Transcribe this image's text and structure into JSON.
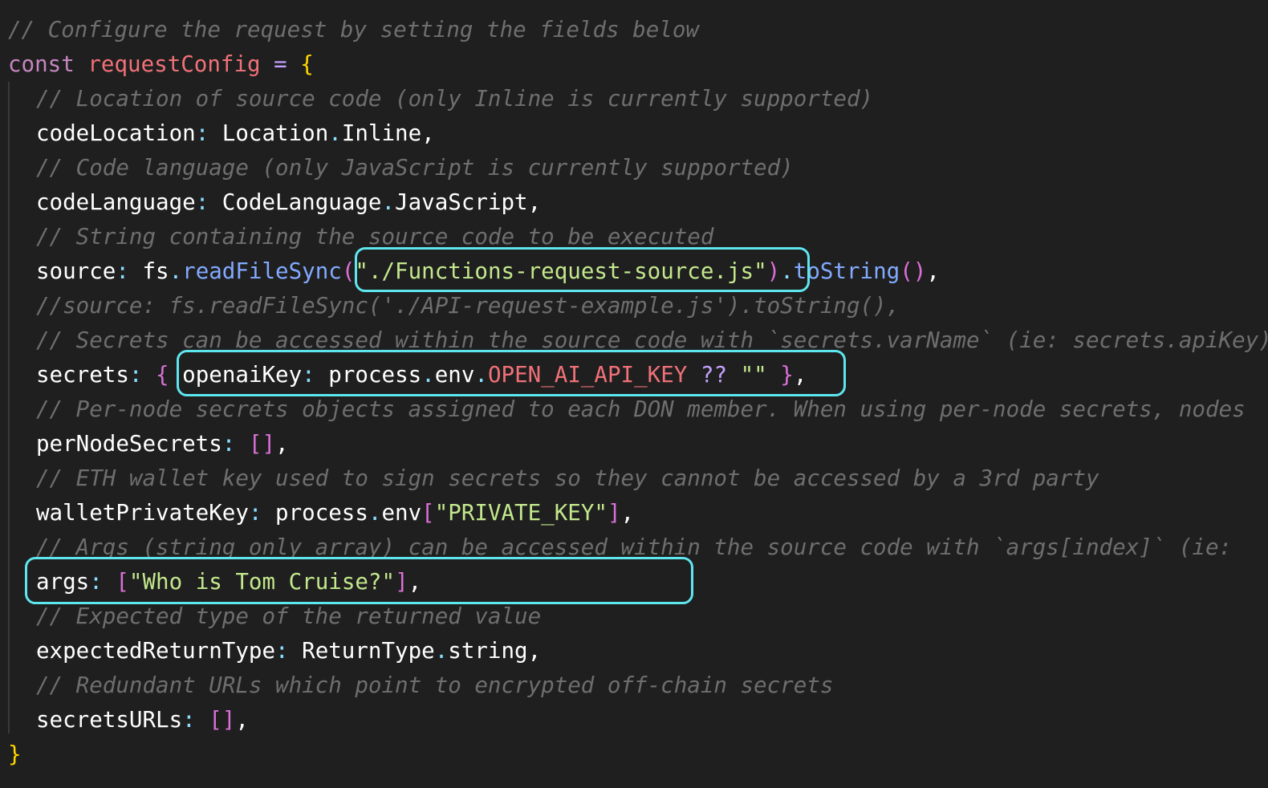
{
  "editor": {
    "lines": [
      {
        "parts": [
          {
            "t": "// Configure the request by setting the fields below",
            "c": "cm"
          }
        ]
      },
      {
        "parts": [
          {
            "t": "const",
            "c": "kw"
          },
          {
            "t": " ",
            "c": "id"
          },
          {
            "t": "requestConfig",
            "c": "var"
          },
          {
            "t": " ",
            "c": "id"
          },
          {
            "t": "=",
            "c": "op"
          },
          {
            "t": " ",
            "c": "id"
          },
          {
            "t": "{",
            "c": "br"
          }
        ]
      },
      {
        "indent": true,
        "parts": [
          {
            "t": "// Location of source code (only Inline is currently supported)",
            "c": "cm"
          }
        ]
      },
      {
        "indent": true,
        "parts": [
          {
            "t": "codeLocation",
            "c": "pr"
          },
          {
            "t": ":",
            "c": "pun"
          },
          {
            "t": " Location",
            "c": "id"
          },
          {
            "t": ".",
            "c": "pun"
          },
          {
            "t": "Inline",
            "c": "id"
          },
          {
            "t": ",",
            "c": "id"
          }
        ]
      },
      {
        "indent": true,
        "parts": [
          {
            "t": "// Code language (only JavaScript is currently supported)",
            "c": "cm"
          }
        ]
      },
      {
        "indent": true,
        "parts": [
          {
            "t": "codeLanguage",
            "c": "pr"
          },
          {
            "t": ":",
            "c": "pun"
          },
          {
            "t": " CodeLanguage",
            "c": "id"
          },
          {
            "t": ".",
            "c": "pun"
          },
          {
            "t": "JavaScript",
            "c": "id"
          },
          {
            "t": ",",
            "c": "id"
          }
        ]
      },
      {
        "indent": true,
        "parts": [
          {
            "t": "// String containing the source code to be executed",
            "c": "cm"
          }
        ]
      },
      {
        "indent": true,
        "parts": [
          {
            "t": "source",
            "c": "pr"
          },
          {
            "t": ":",
            "c": "pun"
          },
          {
            "t": " fs",
            "c": "id"
          },
          {
            "t": ".",
            "c": "pun"
          },
          {
            "t": "readFileSync",
            "c": "fn"
          },
          {
            "t": "(",
            "c": "br2"
          },
          {
            "t": "\"./Functions-request-source.js\"",
            "c": "str"
          },
          {
            "t": ")",
            "c": "br2"
          },
          {
            "t": ".",
            "c": "pun"
          },
          {
            "t": "toString",
            "c": "fn"
          },
          {
            "t": "()",
            "c": "br2"
          },
          {
            "t": ",",
            "c": "id"
          }
        ]
      },
      {
        "indent": true,
        "parts": [
          {
            "t": "//source: fs.readFileSync('./API-request-example.js').toString(),",
            "c": "cm"
          }
        ]
      },
      {
        "indent": true,
        "parts": [
          {
            "t": "// Secrets can be accessed within the source code with `secrets.varName` (ie: secrets.apiKey)",
            "c": "cm"
          }
        ]
      },
      {
        "indent": true,
        "parts": [
          {
            "t": "secrets",
            "c": "pr"
          },
          {
            "t": ":",
            "c": "pun"
          },
          {
            "t": " ",
            "c": "id"
          },
          {
            "t": "{",
            "c": "br2"
          },
          {
            "t": " ",
            "c": "id"
          },
          {
            "t": "openaiKey",
            "c": "pr"
          },
          {
            "t": ":",
            "c": "pun"
          },
          {
            "t": " process",
            "c": "id"
          },
          {
            "t": ".",
            "c": "pun"
          },
          {
            "t": "env",
            "c": "id"
          },
          {
            "t": ".",
            "c": "pun"
          },
          {
            "t": "OPEN_AI_API_KEY",
            "c": "env"
          },
          {
            "t": " ",
            "c": "id"
          },
          {
            "t": "??",
            "c": "op"
          },
          {
            "t": " ",
            "c": "id"
          },
          {
            "t": "\"\"",
            "c": "str"
          },
          {
            "t": " ",
            "c": "id"
          },
          {
            "t": "}",
            "c": "br2"
          },
          {
            "t": ",",
            "c": "id"
          }
        ]
      },
      {
        "indent": true,
        "parts": [
          {
            "t": "// Per-node secrets objects assigned to each DON member. When using per-node secrets, nodes",
            "c": "cm"
          }
        ]
      },
      {
        "indent": true,
        "parts": [
          {
            "t": "perNodeSecrets",
            "c": "pr"
          },
          {
            "t": ":",
            "c": "pun"
          },
          {
            "t": " ",
            "c": "id"
          },
          {
            "t": "[]",
            "c": "br2"
          },
          {
            "t": ",",
            "c": "id"
          }
        ]
      },
      {
        "indent": true,
        "parts": [
          {
            "t": "// ETH wallet key used to sign secrets so they cannot be accessed by a 3rd party",
            "c": "cm"
          }
        ]
      },
      {
        "indent": true,
        "parts": [
          {
            "t": "walletPrivateKey",
            "c": "pr"
          },
          {
            "t": ":",
            "c": "pun"
          },
          {
            "t": " process",
            "c": "id"
          },
          {
            "t": ".",
            "c": "pun"
          },
          {
            "t": "env",
            "c": "id"
          },
          {
            "t": "[",
            "c": "br2"
          },
          {
            "t": "\"PRIVATE_KEY\"",
            "c": "str"
          },
          {
            "t": "]",
            "c": "br2"
          },
          {
            "t": ",",
            "c": "id"
          }
        ]
      },
      {
        "indent": true,
        "parts": [
          {
            "t": "// Args (string only array) can be accessed within the source code with `args[index]` (ie:",
            "c": "cm"
          }
        ]
      },
      {
        "indent": true,
        "parts": [
          {
            "t": "args",
            "c": "pr"
          },
          {
            "t": ":",
            "c": "pun"
          },
          {
            "t": " ",
            "c": "id"
          },
          {
            "t": "[",
            "c": "br2"
          },
          {
            "t": "\"Who is Tom Cruise?\"",
            "c": "str"
          },
          {
            "t": "]",
            "c": "br2"
          },
          {
            "t": ",",
            "c": "id"
          }
        ]
      },
      {
        "indent": true,
        "parts": [
          {
            "t": "// Expected type of the returned value",
            "c": "cm"
          }
        ]
      },
      {
        "indent": true,
        "parts": [
          {
            "t": "expectedReturnType",
            "c": "pr"
          },
          {
            "t": ":",
            "c": "pun"
          },
          {
            "t": " ReturnType",
            "c": "id"
          },
          {
            "t": ".",
            "c": "pun"
          },
          {
            "t": "string",
            "c": "id"
          },
          {
            "t": ",",
            "c": "id"
          }
        ]
      },
      {
        "indent": true,
        "parts": [
          {
            "t": "// Redundant URLs which point to encrypted off-chain secrets",
            "c": "cm"
          }
        ]
      },
      {
        "indent": true,
        "parts": [
          {
            "t": "secretsURLs",
            "c": "pr"
          },
          {
            "t": ":",
            "c": "pun"
          },
          {
            "t": " ",
            "c": "id"
          },
          {
            "t": "[]",
            "c": "br2"
          },
          {
            "t": ",",
            "c": "id"
          }
        ]
      },
      {
        "parts": [
          {
            "t": "}",
            "c": "br"
          }
        ]
      }
    ]
  },
  "highlight_color": "#5ee6ee"
}
